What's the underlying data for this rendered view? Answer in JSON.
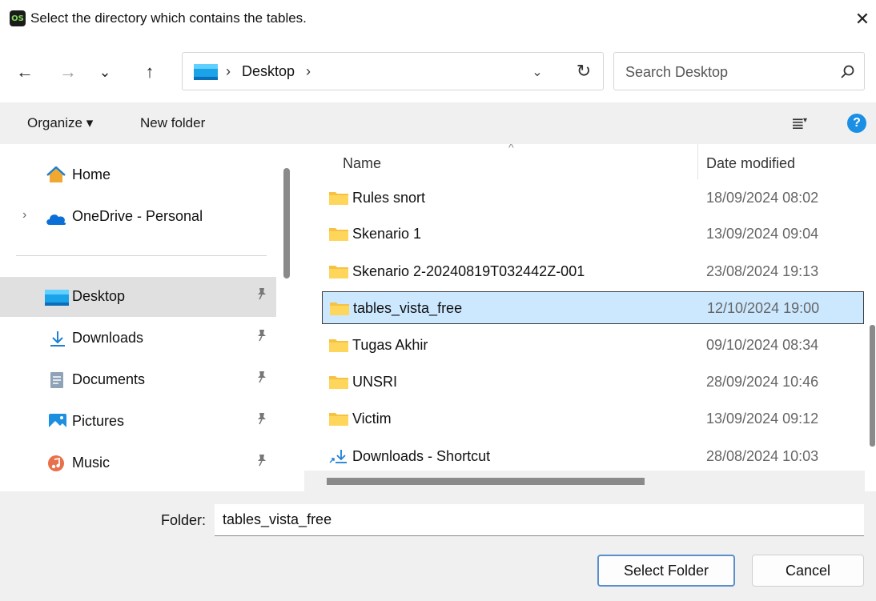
{
  "window": {
    "app_icon_text": "OS",
    "title": "Select the directory which contains the tables.",
    "close_glyph": "✕"
  },
  "nav": {
    "back_icon": "arrow-left-icon",
    "forward_icon": "arrow-right-icon",
    "recent_icon": "chevron-down-icon",
    "up_icon": "arrow-up-icon",
    "back_glyph": "←",
    "forward_glyph": "→",
    "recent_glyph": "⌄",
    "up_glyph": "↑"
  },
  "address": {
    "separator": "›",
    "location": "Desktop",
    "dropdown_glyph": "⌄",
    "refresh_glyph": "↻"
  },
  "search": {
    "placeholder": "Search Desktop"
  },
  "toolbar": {
    "organize_label": "Organize ▾",
    "new_folder_label": "New folder",
    "view_glyph": "≣",
    "view_caret": "▾",
    "help_glyph": "?"
  },
  "sidebar": {
    "items": [
      {
        "label": "Home",
        "icon": "home-icon"
      },
      {
        "label": "OneDrive - Personal",
        "icon": "cloud-icon"
      },
      {
        "label": "Desktop",
        "icon": "desktop-folder-icon",
        "pinned": true,
        "selected": true
      },
      {
        "label": "Downloads",
        "icon": "download-icon",
        "pinned": true
      },
      {
        "label": "Documents",
        "icon": "document-icon",
        "pinned": true
      },
      {
        "label": "Pictures",
        "icon": "pictures-icon",
        "pinned": true
      },
      {
        "label": "Music",
        "icon": "music-icon",
        "pinned": true
      }
    ],
    "expander_glyph": "›",
    "pin_glyph": "📌"
  },
  "files": {
    "columns": {
      "name": "Name",
      "date": "Date modified",
      "sort_glyph": "^"
    },
    "rows": [
      {
        "name": "Rules snort",
        "date": "18/09/2024 08:02",
        "type": "folder"
      },
      {
        "name": "Skenario 1",
        "date": "13/09/2024 09:04",
        "type": "folder"
      },
      {
        "name": "Skenario 2-20240819T032442Z-001",
        "date": "23/08/2024 19:13",
        "type": "folder"
      },
      {
        "name": "tables_vista_free",
        "date": "12/10/2024 19:00",
        "type": "folder",
        "selected": true
      },
      {
        "name": "Tugas Akhir",
        "date": "09/10/2024 08:34",
        "type": "folder"
      },
      {
        "name": "UNSRI",
        "date": "28/09/2024 10:46",
        "type": "folder"
      },
      {
        "name": "Victim",
        "date": "13/09/2024 09:12",
        "type": "folder"
      },
      {
        "name": "Downloads - Shortcut",
        "date": "28/08/2024 10:03",
        "type": "shortcut"
      }
    ]
  },
  "footer": {
    "folder_label": "Folder:",
    "folder_value": "tables_vista_free",
    "select_button": "Select Folder",
    "cancel_button": "Cancel"
  },
  "colors": {
    "folder_yellow": "#f5c242",
    "selection_bg": "#cce8ff",
    "accent_blue": "#1a8fe3"
  }
}
